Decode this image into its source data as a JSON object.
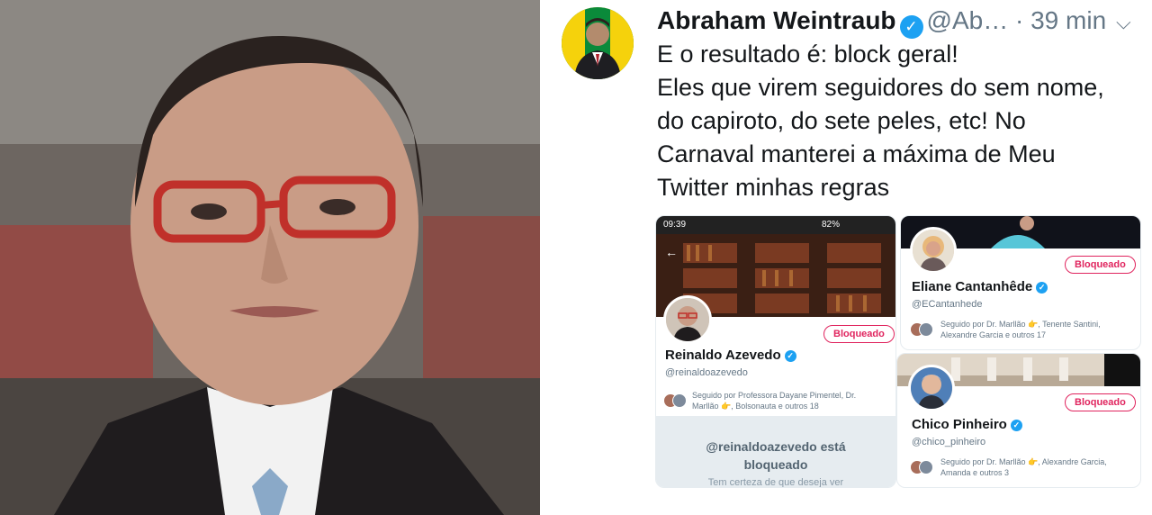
{
  "tweet": {
    "author_name": "Abraham Weintraub",
    "verified_glyph": "✓",
    "handle": "@Ab…",
    "separator": "·",
    "time": "39 min",
    "menu_glyph": "⌵",
    "text_lines": [
      "E o resultado é: block geral!",
      "Eles que virem seguidores do sem nome,",
      "do capiroto, do sete peles, etc! No",
      "Carnaval manterei a máxima de Meu",
      "Twitter minhas regras"
    ]
  },
  "phone_status": {
    "time": "09:39",
    "battery": "82%",
    "back_glyph": "←"
  },
  "profiles": [
    {
      "name": "Reinaldo Azevedo",
      "handle": "@reinaldoazevedo",
      "button": "Bloqueado",
      "followed_by": "Seguido por Professora Dayane Pimentel, Dr. Marllão 👉, Bolsonauta e outros 18",
      "blocked_title_1": "@reinaldoazevedo está",
      "blocked_title_2": "bloqueado",
      "blocked_sub": "Tem certeza de que deseja ver"
    },
    {
      "name": "Eliane Cantanhêde",
      "handle": "@ECantanhede",
      "button": "Bloqueado",
      "followed_by": "Seguido por Dr. Marllão 👉, Tenente Santini, Alexandre Garcia e outros 17"
    },
    {
      "name": "Chico Pinheiro",
      "handle": "@chico_pinheiro",
      "button": "Bloqueado",
      "followed_by": "Seguido por Dr. Marllão 👉, Alexandre Garcia, Amanda e outros 3"
    }
  ],
  "colors": {
    "twitter_blue": "#1da1f2",
    "blocked_red": "#e0245e",
    "text_primary": "#14171a",
    "text_secondary": "#657786"
  }
}
